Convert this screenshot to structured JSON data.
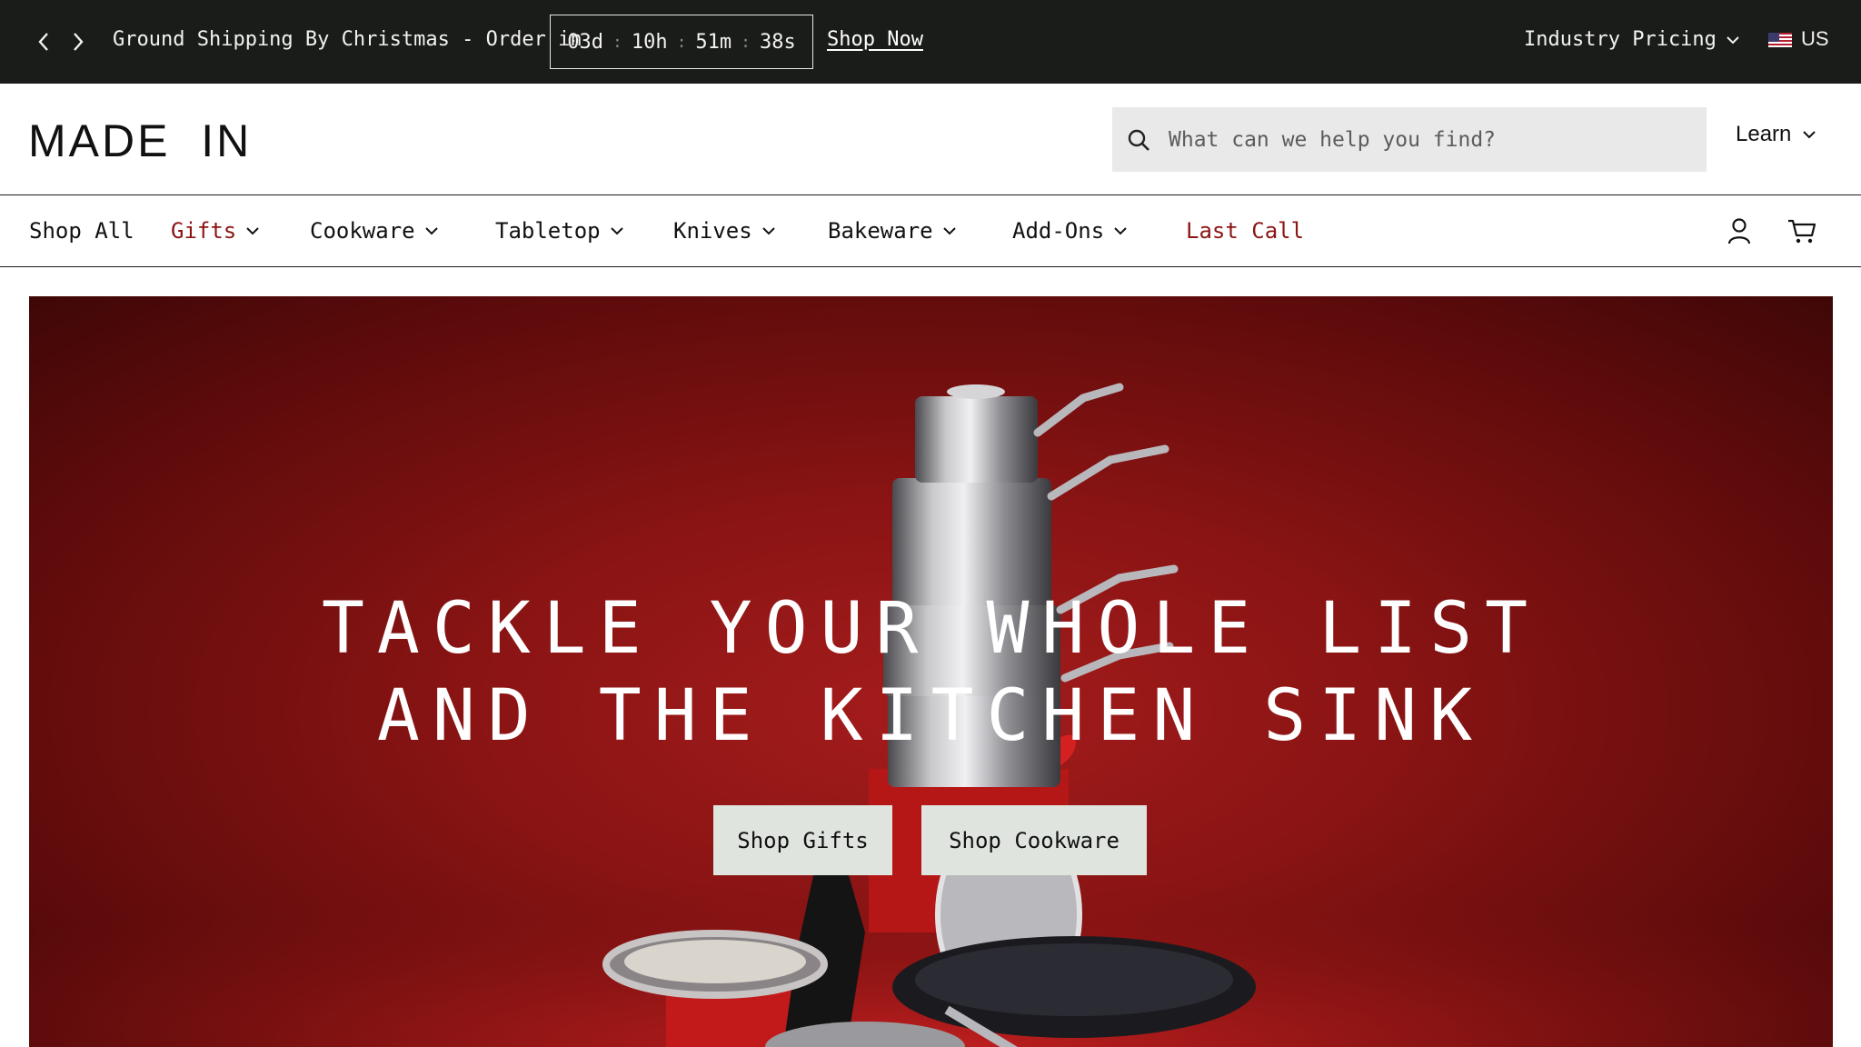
{
  "announcement": {
    "message": "Ground Shipping By Christmas - Order in",
    "countdown": {
      "days": "03d",
      "hours": "10h",
      "minutes": "51m",
      "seconds": "38s",
      "separator": ":"
    },
    "cta": "Shop Now",
    "industry_pricing": "Industry Pricing",
    "locale": "US",
    "background": "#1a1c19"
  },
  "header": {
    "logo": "MADE  IN",
    "search_placeholder": "What can we help you find?",
    "learn": "Learn"
  },
  "nav": {
    "items": [
      {
        "label": "Shop All",
        "dropdown": false,
        "color": "#111111"
      },
      {
        "label": "Gifts",
        "dropdown": true,
        "color": "#8c1414"
      },
      {
        "label": "Cookware",
        "dropdown": true,
        "color": "#111111"
      },
      {
        "label": "Tabletop",
        "dropdown": true,
        "color": "#111111"
      },
      {
        "label": "Knives",
        "dropdown": true,
        "color": "#111111"
      },
      {
        "label": "Bakeware",
        "dropdown": true,
        "color": "#111111"
      },
      {
        "label": "Add-Ons",
        "dropdown": true,
        "color": "#111111"
      },
      {
        "label": "Last Call",
        "dropdown": false,
        "color": "#8c1414"
      }
    ],
    "icons": [
      "account-icon",
      "cart-icon"
    ]
  },
  "hero": {
    "title_line1": "TACKLE YOUR WHOLE LIST",
    "title_line2": "AND THE KITCHEN SINK",
    "buttons": [
      "Shop Gifts",
      "Shop Cookware"
    ],
    "background": "#8b1414"
  }
}
